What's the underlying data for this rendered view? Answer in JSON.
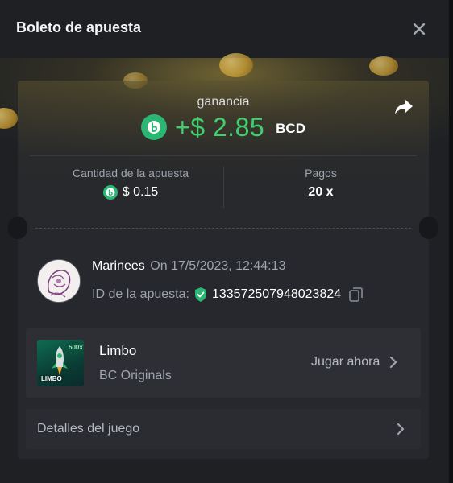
{
  "modal": {
    "title": "Boleto de apuesta",
    "close_icon": "close-icon"
  },
  "ticket": {
    "profit_label": "ganancia",
    "profit_amount": "+$ 2.85",
    "currency": "BCD",
    "currency_icon": "bcd-coin-icon",
    "share_icon": "share-icon",
    "bet_amount_label": "Cantidad de la apuesta",
    "bet_amount_value": "$ 0.15",
    "payout_label": "Pagos",
    "payout_value": "20 x"
  },
  "bet": {
    "username": "Marinees",
    "date": "On 17/5/2023, 12:44:13",
    "bet_id_label": "ID de la apuesta:",
    "bet_id_value": "133572507948023824",
    "verified_icon": "shield-check-icon",
    "copy_icon": "copy-icon"
  },
  "game": {
    "name": "Limbo",
    "provider": "BC Originals",
    "thumb_text": "LIMBO",
    "thumb_badge": "500x",
    "play_label": "Jugar ahora"
  },
  "details": {
    "label": "Detalles del juego"
  },
  "colors": {
    "win_green": "#3ed06e",
    "bcd_green": "#2bb673",
    "panel_bg": "#1e2024"
  }
}
